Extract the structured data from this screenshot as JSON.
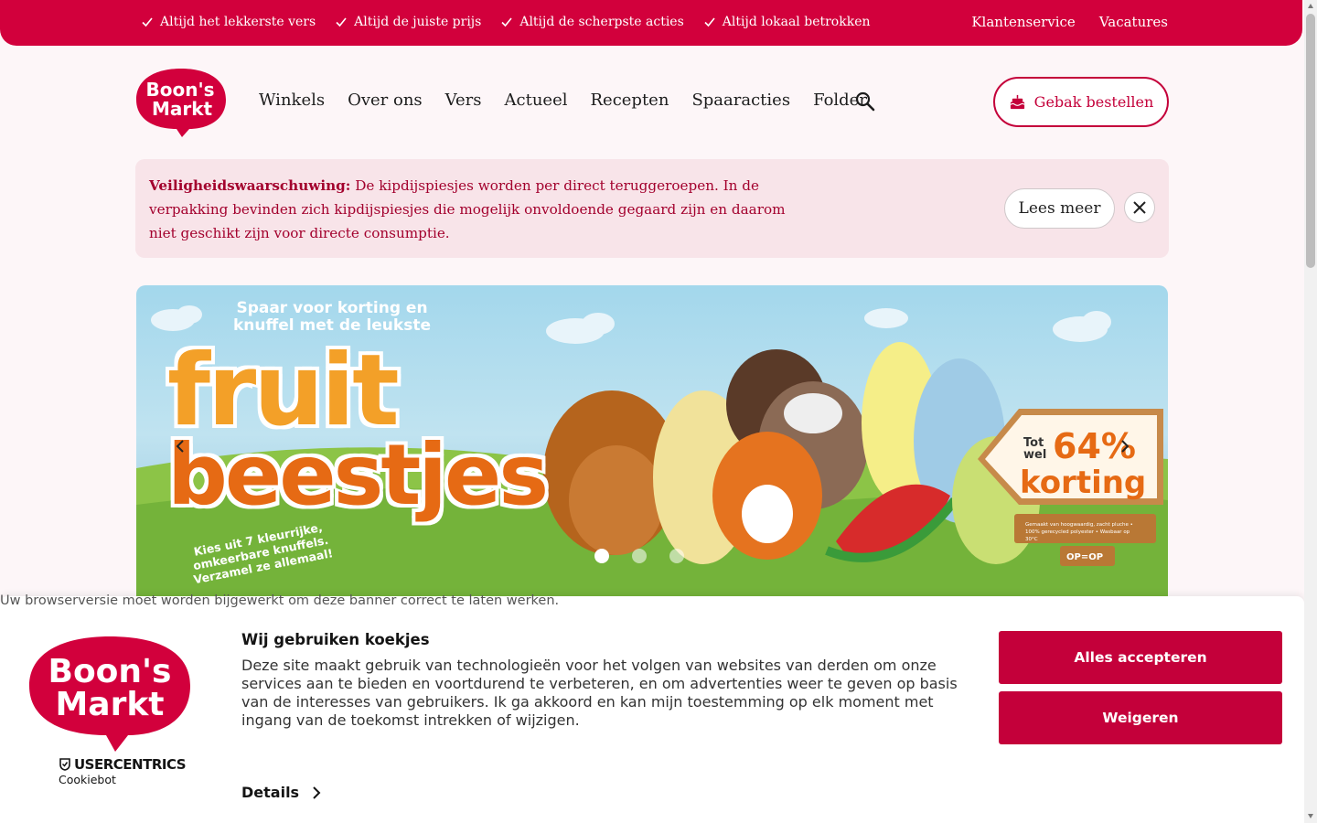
{
  "topbar": {
    "usps": [
      "Altijd het lekkerste vers",
      "Altijd de juiste prijs",
      "Altijd de scherpste acties",
      "Altijd lokaal betrokken"
    ],
    "links": [
      "Klantenservice",
      "Vacatures"
    ]
  },
  "header": {
    "logo_text": [
      "Boon's",
      "Markt"
    ],
    "nav": [
      "Winkels",
      "Over ons",
      "Vers",
      "Actueel",
      "Recepten",
      "Spaaracties",
      "Folder"
    ],
    "cta_label": "Gebak bestellen"
  },
  "alert": {
    "title": "Veiligheidswaarschuwing:",
    "message": "De kipdijspiesjes worden per direct teruggeroepen. In de verpakking bevinden zich kipdijspiesjes die mogelijk onvoldoende gegaard zijn en daarom niet geschikt zijn voor directe consumptie.",
    "button": "Lees meer"
  },
  "hero": {
    "tagline": "Spaar voor korting en knuffel met de leukste",
    "title_line1": "fruit",
    "title_line2": "beestjes",
    "subtitle": "Kies uit 7 kleurrijke, omkeerbare knuffels. Verzamel ze allemaal!",
    "sign_tot": "Tot wel",
    "sign_pct": "64%",
    "sign_korting": "korting",
    "sign_small": "Gemaakt van hoogwaardig, zacht pluche • 100% gerecycled polyester • Wasbaar op 30°C",
    "sign_op": "OP=OP",
    "slide_count": 3,
    "active_slide": 1
  },
  "cookie": {
    "browser_warning": "Uw browserversie moet worden bijgewerkt om deze banner correct te laten werken.",
    "logo_text": [
      "Boon's",
      "Markt"
    ],
    "provider": "USERCENTRICS",
    "provider_sub": "Cookiebot",
    "title": "Wij gebruiken koekjes",
    "text": "Deze site maakt gebruik van technologieën voor het volgen van websites van derden om onze services aan te bieden en voortdurend te verbeteren, en om advertenties weer te geven op basis van de interesses van gebruikers. Ik ga akkoord en kan mijn toestemming op elk moment met ingang van de toekomst intrekken of wijzigen.",
    "details": "Details",
    "accept": "Alles accepteren",
    "decline": "Weigeren"
  },
  "colors": {
    "brand": "#d2003c",
    "alert_bg": "#f8e4e9",
    "alert_text": "#a3002d"
  }
}
